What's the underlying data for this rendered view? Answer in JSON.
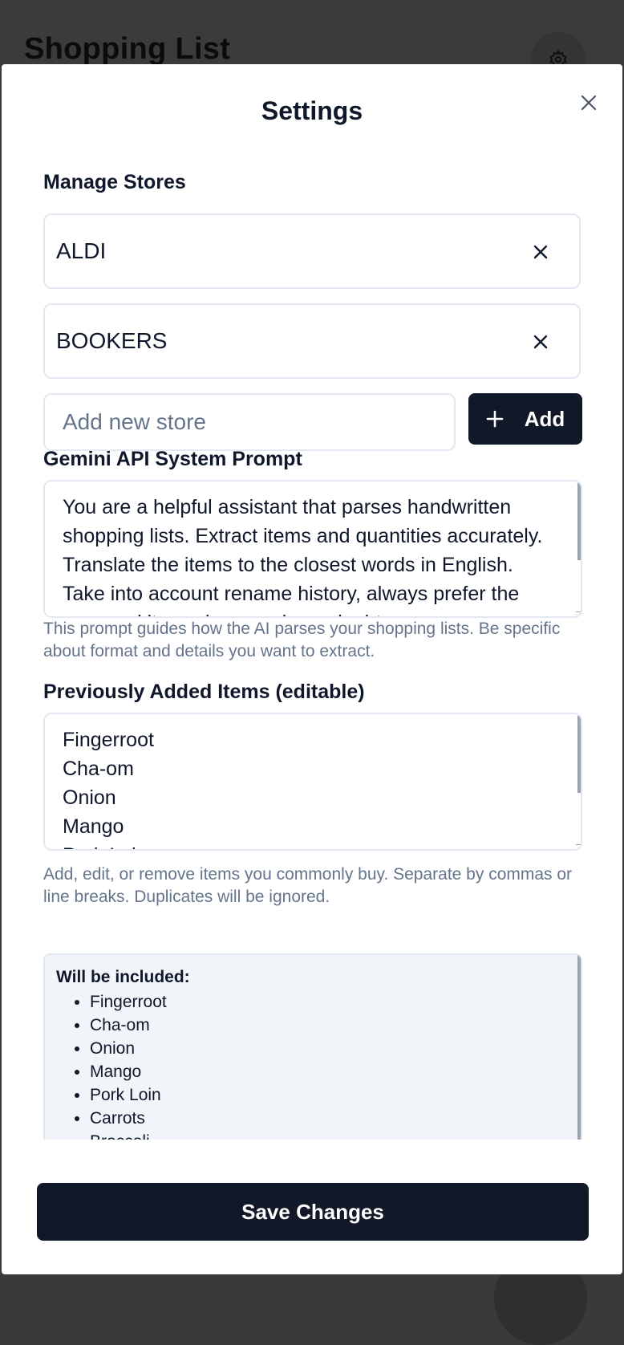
{
  "background": {
    "app_title": "Shopping List"
  },
  "modal": {
    "title": "Settings",
    "manage_stores_label": "Manage Stores",
    "stores": [
      {
        "name": "ALDI"
      },
      {
        "name": "BOOKERS"
      }
    ],
    "new_store_placeholder": "Add new store",
    "add_button_label": "Add",
    "prompt_label": "Gemini API System Prompt",
    "prompt_value": "You are a helpful assistant that parses handwritten shopping lists. Extract items and quantities accurately.  Translate the items to the closest words in English.  Take into account rename history, always prefer the renamed item when you have doubts",
    "prompt_help": "This prompt guides how the AI parses your shopping lists. Be specific about format and details you want to extract.",
    "items_label": "Previously Added Items (editable)",
    "items_value": "Fingerroot\nCha-om\nOnion\nMango\nPork Loin\nCarrots\nBroccoli",
    "items_help": "Add, edit, or remove items you commonly buy. Separate by commas or line breaks. Duplicates will be ignored.",
    "preview_heading": "Will be included:",
    "preview_items": [
      "Fingerroot",
      "Cha-om",
      "Onion",
      "Mango",
      "Pork Loin",
      "Carrots",
      "Broccoli"
    ],
    "save_button_label": "Save Changes"
  },
  "colors": {
    "primary_button": "#111827",
    "muted_text": "#64748b",
    "border": "#e2e8f0",
    "preview_bg": "#f1f5f9"
  }
}
